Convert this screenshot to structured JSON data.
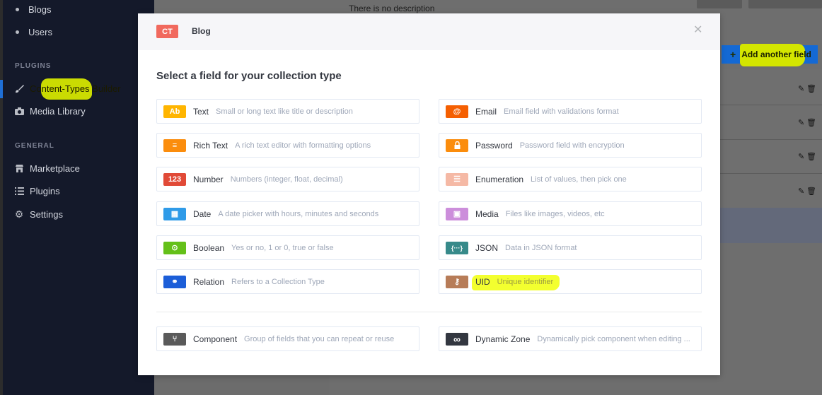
{
  "sidebar": {
    "items_top": [
      {
        "label": "Blogs"
      },
      {
        "label": "Users"
      }
    ],
    "plugins_title": "PLUGINS",
    "plugins": [
      {
        "label": "Content-Types Builder",
        "icon": "paintbrush-icon",
        "active": true
      },
      {
        "label": "Media Library",
        "icon": "camera-icon"
      }
    ],
    "general_title": "GENERAL",
    "general": [
      {
        "label": "Marketplace",
        "icon": "shop-icon"
      },
      {
        "label": "Plugins",
        "icon": "list-icon"
      },
      {
        "label": "Settings",
        "icon": "gear-icon"
      }
    ]
  },
  "background": {
    "description": "There is no description",
    "add_field_label": "Add another field"
  },
  "modal": {
    "badge": "CT",
    "header_title": "Blog",
    "title": "Select a field for your collection type",
    "fields_left": [
      {
        "name": "Text",
        "desc": "Small or long text like title or description",
        "icon_text": "Ab",
        "color": "#ffb500",
        "icon": "text-icon"
      },
      {
        "name": "Rich Text",
        "desc": "A rich text editor with formatting options",
        "icon_text": "≡",
        "color": "#fb8d0d",
        "icon": "richtext-icon"
      },
      {
        "name": "Number",
        "desc": "Numbers (integer, float, decimal)",
        "icon_text": "123",
        "color": "#e14a37",
        "icon": "number-icon"
      },
      {
        "name": "Date",
        "desc": "A date picker with hours, minutes and seconds",
        "icon_text": "▦",
        "color": "#2f9be8",
        "icon": "calendar-icon"
      },
      {
        "name": "Boolean",
        "desc": "Yes or no, 1 or 0, true or false",
        "icon_text": "⊙",
        "color": "#64c019",
        "icon": "toggle-icon"
      },
      {
        "name": "Relation",
        "desc": "Refers to a Collection Type",
        "icon_text": "⚭",
        "color": "#1c5ed8",
        "icon": "relation-icon"
      }
    ],
    "fields_right": [
      {
        "name": "Email",
        "desc": "Email field with validations format",
        "icon_text": "@",
        "color": "#f55f01",
        "icon": "at-icon"
      },
      {
        "name": "Password",
        "desc": "Password field with encryption",
        "icon_text": "🔒",
        "color": "#fb8d0d",
        "icon": "lock-icon"
      },
      {
        "name": "Enumeration",
        "desc": "List of values, then pick one",
        "icon_text": "☰",
        "color": "#f5b9a5",
        "icon": "enumeration-icon"
      },
      {
        "name": "Media",
        "desc": "Files like images, videos, etc",
        "icon_text": "▣",
        "color": "#cc8edb",
        "icon": "image-icon"
      },
      {
        "name": "JSON",
        "desc": "Data in JSON format",
        "icon_text": "{···}",
        "color": "#378a8a",
        "icon": "json-icon"
      },
      {
        "name": "UID",
        "desc": "Unique identifier",
        "icon_text": "⚷",
        "color": "#b77c58",
        "icon": "key-icon"
      }
    ],
    "special_fields": [
      {
        "name": "Component",
        "desc": "Group of fields that you can repeat or reuse",
        "icon_text": "⑂",
        "color": "#5a5a5a",
        "icon": "component-icon"
      },
      {
        "name": "Dynamic Zone",
        "desc": "Dynamically pick component when editing ...",
        "icon_text": "∞",
        "color": "#333740",
        "icon": "infinity-icon"
      }
    ]
  }
}
